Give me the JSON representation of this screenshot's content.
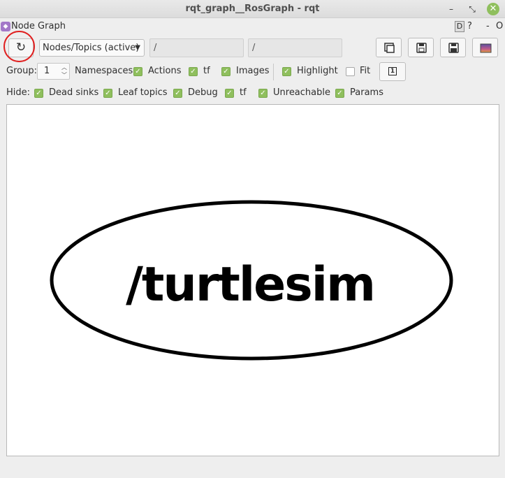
{
  "window": {
    "title": "rqt_graph__RosGraph - rqt",
    "minimize_glyph": "–",
    "restore_glyph": "⤡",
    "close_glyph": "✕"
  },
  "plugin": {
    "title": "Node Graph",
    "d_label": "D",
    "help_label": "?",
    "dash_label": "-",
    "o_label": "O"
  },
  "toolbar": {
    "refresh_icon": "↻",
    "view_mode": "Nodes/Topics (active)",
    "node_filter": "/",
    "topic_filter": "/"
  },
  "options": {
    "group_label": "Group:",
    "group_value": "1",
    "namespaces_label": "Namespaces",
    "actions_label": "Actions",
    "tf_label": "tf",
    "images_label": "Images",
    "highlight_label": "Highlight",
    "fit_label": "Fit",
    "fit_button": "1"
  },
  "hide": {
    "label": "Hide:",
    "dead_sinks": "Dead sinks",
    "leaf_topics": "Leaf topics",
    "debug": "Debug",
    "tf": "tf",
    "unreachable": "Unreachable",
    "params": "Params"
  },
  "graph": {
    "nodes": [
      {
        "name": "/turtlesim"
      }
    ]
  }
}
